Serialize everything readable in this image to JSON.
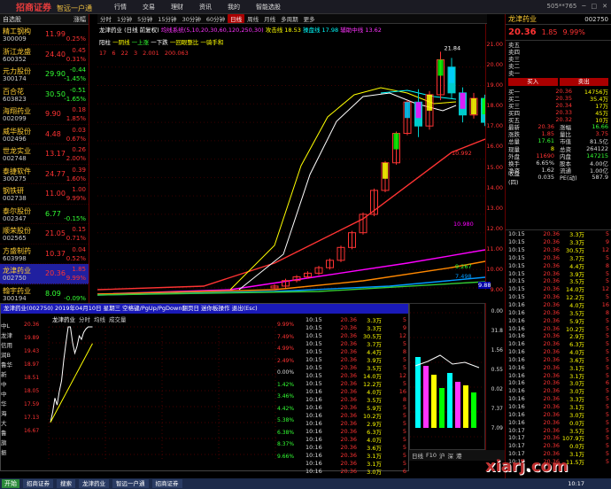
{
  "app": {
    "logo": "招商证券",
    "slogan": "智远一户通",
    "menu": [
      "行情",
      "交易",
      "理财",
      "资讯",
      "我的",
      "智能选股"
    ],
    "title_right": [
      "505**765",
      "─",
      "□",
      "✕"
    ]
  },
  "left_list": {
    "header_left": "自选股",
    "header_right": "涨幅",
    "rows": [
      {
        "name": "精工钢构",
        "code": "300009",
        "price": "11.99",
        "pct": "0.25%",
        "val": "",
        "color": "#f33"
      },
      {
        "name": "浙江龙盛",
        "code": "600352",
        "price": "24.40",
        "pct": "0.31%",
        "val": "0.45",
        "color": "#f33"
      },
      {
        "name": "元力股份",
        "code": "300174",
        "price": "29.90",
        "pct": "-1.45%",
        "val": "-0.44",
        "color": "#3f3"
      },
      {
        "name": "百合花",
        "code": "603823",
        "price": "30.50",
        "pct": "-1.65%",
        "val": "-0.51",
        "color": "#3f3"
      },
      {
        "name": "海翔药业",
        "code": "002099",
        "price": "9.90",
        "pct": "1.85%",
        "val": "0.18",
        "color": "#f33"
      },
      {
        "name": "威华股份",
        "code": "002496",
        "price": "4.48",
        "pct": "0.67%",
        "val": "0.03",
        "color": "#f33"
      },
      {
        "name": "世龙实业",
        "code": "002748",
        "price": "13.17",
        "price_color": "#f33",
        "pct": "2.00%",
        "val": "0.26",
        "color": "#f33"
      },
      {
        "name": "泰捷软件",
        "code": "300275",
        "price": "24.77",
        "pct": "1.60%",
        "val": "0.39",
        "color": "#f33"
      },
      {
        "name": "钢铁研",
        "code": "002738",
        "price": "11.00",
        "pct": "9.99%",
        "val": "1.00",
        "color": "#f33"
      },
      {
        "name": "泰尔股份",
        "code": "002347",
        "price": "6.77",
        "pct": "-0.15%",
        "val": "",
        "color": "#3f3"
      },
      {
        "name": "顺荣股份",
        "code": "002565",
        "price": "21.05",
        "pct": "0.71%",
        "val": "0.15",
        "color": "#f33"
      },
      {
        "name": "方盛制药",
        "code": "603998",
        "price": "10.37",
        "pct": "0.52%",
        "val": "0.04",
        "color": "#f33"
      },
      {
        "name": "龙津药业",
        "code": "002750",
        "price": "20.36",
        "pct": "9.99%",
        "val": "1.85",
        "color": "#f33"
      },
      {
        "name": "翰宇药业",
        "code": "300194",
        "price": "8.09",
        "pct": "-0.09%",
        "val": "",
        "color": "#3f3"
      }
    ]
  },
  "chart": {
    "toolbar": [
      "分时",
      "1分钟",
      "5分钟",
      "15分钟",
      "30分钟",
      "60分钟",
      "日线",
      "周线",
      "月线",
      "多周期",
      "更多"
    ],
    "toolbar_active": "日线",
    "ma_legend_title": "龙津药业 (日线 前复权)",
    "ma_legend_params": "均线系统(5,10,20,30,60,120,250,30)",
    "ma_legend_extra1": "攻击线 18.53",
    "ma_legend_extra2": "操盘线 17.98",
    "ma_legend_extra3": "辅助中线 13.62",
    "pattern_line": [
      "阳柱",
      "一阴线",
      "一上涨",
      "一下跌",
      "一回眼整比",
      "一骑手和"
    ],
    "pattern_values": [
      "17",
      "6",
      "22",
      "3",
      "2.001",
      "200.063"
    ],
    "annotations": {
      "high": "21.84",
      "low": "9.17",
      "ma1": "10.992",
      "ma2": "10.980",
      "ma3": "9.267",
      "ma4": "7.498",
      "v1": "9.88",
      "v2": "9.80"
    },
    "bottom_labels": [
      "买进",
      "卖出"
    ],
    "price_axis": [
      "21.00",
      "20.00",
      "19.00",
      "18.00",
      "17.00",
      "16.00",
      "15.00",
      "14.00",
      "13.00",
      "12.00",
      "11.00",
      "10.00",
      "9.00"
    ],
    "chart_data": {
      "type": "candlestick",
      "candles": [
        {
          "open": 9.0,
          "close": 9.1,
          "high": 9.2,
          "low": 8.9
        },
        {
          "open": 9.1,
          "close": 9.4,
          "high": 9.5,
          "low": 9.0
        },
        {
          "open": 9.4,
          "close": 9.6,
          "high": 9.7,
          "low": 9.3
        },
        {
          "open": 9.6,
          "close": 9.8,
          "high": 9.9,
          "low": 9.5
        },
        {
          "open": 9.8,
          "close": 10.1,
          "high": 10.2,
          "low": 9.7
        },
        {
          "open": 10.1,
          "close": 10.5,
          "high": 10.6,
          "low": 10.0
        },
        {
          "open": 10.5,
          "close": 11.2,
          "high": 11.3,
          "low": 10.4
        },
        {
          "open": 11.2,
          "close": 12.0,
          "high": 12.1,
          "low": 11.1
        },
        {
          "open": 12.0,
          "close": 13.0,
          "high": 13.1,
          "low": 11.9
        },
        {
          "open": 13.0,
          "close": 14.3,
          "high": 14.4,
          "low": 12.9
        },
        {
          "open": 14.3,
          "close": 15.8,
          "high": 15.9,
          "low": 14.2
        },
        {
          "open": 15.8,
          "close": 17.4,
          "high": 17.5,
          "low": 15.7
        },
        {
          "open": 17.4,
          "close": 19.1,
          "high": 19.2,
          "low": 17.3
        },
        {
          "open": 19.1,
          "close": 17.8,
          "high": 19.8,
          "low": 17.2
        },
        {
          "open": 17.8,
          "close": 19.5,
          "high": 19.7,
          "low": 17.6
        },
        {
          "open": 19.5,
          "close": 21.4,
          "high": 21.84,
          "low": 19.2
        },
        {
          "open": 21.0,
          "close": 19.6,
          "high": 21.5,
          "low": 19.3
        },
        {
          "open": 19.6,
          "close": 18.4,
          "high": 19.9,
          "low": 18.0
        },
        {
          "open": 18.4,
          "close": 19.3,
          "high": 19.6,
          "low": 18.2
        },
        {
          "open": 19.3,
          "close": 18.0,
          "high": 19.5,
          "low": 17.8
        },
        {
          "open": 18.0,
          "close": 17.2,
          "high": 18.3,
          "low": 16.9
        },
        {
          "open": 17.2,
          "close": 18.1,
          "high": 18.4,
          "low": 17.0
        },
        {
          "open": 18.1,
          "close": 17.5,
          "high": 18.3,
          "low": 17.2
        },
        {
          "open": 17.5,
          "close": 18.51,
          "high": 18.8,
          "low": 17.3
        },
        {
          "open": 18.51,
          "close": 20.36,
          "high": 20.36,
          "low": 18.5
        }
      ],
      "ylim": [
        9,
        22
      ]
    }
  },
  "quote": {
    "name": "龙津药业",
    "code": "002750",
    "price": "20.36",
    "change": "1.85",
    "pct": "9.99%",
    "asks": [
      {
        "l": "卖五",
        "v": "",
        "q": ""
      },
      {
        "l": "卖四",
        "v": "",
        "q": ""
      },
      {
        "l": "卖三",
        "v": "",
        "q": ""
      },
      {
        "l": "卖二",
        "v": "",
        "q": ""
      },
      {
        "l": "卖一",
        "v": "",
        "q": ""
      }
    ],
    "bids": [
      {
        "l": "买一",
        "v": "20.36",
        "q": "14756万"
      },
      {
        "l": "买二",
        "v": "20.35",
        "q": "35.4万"
      },
      {
        "l": "买三",
        "v": "20.34",
        "q": "17万"
      },
      {
        "l": "买四",
        "v": "20.33",
        "q": "45万"
      },
      {
        "l": "买五",
        "v": "20.32",
        "q": "10万"
      }
    ],
    "buttons": [
      "买入",
      "卖出"
    ],
    "stats": [
      {
        "k": "最新",
        "v": "20.36",
        "vc": "red",
        "k2": "涨幅",
        "v2": "16.66",
        "v2c": "grn"
      },
      {
        "k": "涨跌",
        "v": "1.85",
        "vc": "red",
        "k2": "量比",
        "v2": "3.75",
        "v2c": "red"
      },
      {
        "k": "总量",
        "v": "17.61",
        "vc": "grn",
        "k2": "市值",
        "v2": "81.5亿",
        "v2c": "wht"
      },
      {
        "k": "现量",
        "v": "8",
        "vc": "yel",
        "k2": "总资",
        "v2": "264122",
        "v2c": "wht"
      },
      {
        "k": "外盘",
        "v": "11690",
        "vc": "red",
        "k2": "内盘",
        "v2": "147215",
        "v2c": "grn"
      },
      {
        "k": "换手",
        "v": "6.65%",
        "vc": "wht",
        "k2": "股本",
        "v2": "4.00亿",
        "v2c": "wht"
      },
      {
        "k": "净资",
        "v": "1.62",
        "vc": "wht",
        "k2": "流通",
        "v2": "1.00亿",
        "v2c": "wht"
      },
      {
        "k": "收益(四)",
        "v": "0.035",
        "vc": "wht",
        "k2": "PE(动)",
        "v2": "587.9",
        "v2c": "wht"
      }
    ],
    "ticks": [
      {
        "t": "10:15",
        "p": "20.36",
        "v": "3.3万",
        "d": "5"
      },
      {
        "t": "10:15",
        "p": "20.36",
        "v": "3.3万",
        "d": "9"
      },
      {
        "t": "10:15",
        "p": "20.36",
        "v": "30.5万",
        "d": "12"
      },
      {
        "t": "10:15",
        "p": "20.36",
        "v": "3.7万",
        "d": "5"
      },
      {
        "t": "10:15",
        "p": "20.36",
        "v": "4.4万",
        "d": "8"
      },
      {
        "t": "10:15",
        "p": "20.36",
        "v": "3.9万",
        "d": "5"
      },
      {
        "t": "10:15",
        "p": "20.36",
        "v": "3.5万",
        "d": "5"
      },
      {
        "t": "10:15",
        "p": "20.36",
        "v": "14.0万",
        "d": "12"
      },
      {
        "t": "10:15",
        "p": "20.36",
        "v": "12.2万",
        "d": "5"
      },
      {
        "t": "10:16",
        "p": "20.36",
        "v": "4.0万",
        "d": "16"
      },
      {
        "t": "10:16",
        "p": "20.36",
        "v": "3.5万",
        "d": "8"
      },
      {
        "t": "10:16",
        "p": "20.36",
        "v": "5.9万",
        "d": "5"
      },
      {
        "t": "10:16",
        "p": "20.36",
        "v": "10.2万",
        "d": "5"
      },
      {
        "t": "10:16",
        "p": "20.36",
        "v": "2.9万",
        "d": "5"
      },
      {
        "t": "10:16",
        "p": "20.36",
        "v": "6.3万",
        "d": "5"
      },
      {
        "t": "10:16",
        "p": "20.36",
        "v": "4.0万",
        "d": "5"
      },
      {
        "t": "10:16",
        "p": "20.36",
        "v": "3.6万",
        "d": "5"
      },
      {
        "t": "10:16",
        "p": "20.36",
        "v": "3.1万",
        "d": "5"
      },
      {
        "t": "10:16",
        "p": "20.36",
        "v": "3.1万",
        "d": "5"
      },
      {
        "t": "10:16",
        "p": "20.36",
        "v": "3.0万",
        "d": "6"
      },
      {
        "t": "10:16",
        "p": "20.36",
        "v": "3.0万",
        "d": "5"
      },
      {
        "t": "10:16",
        "p": "20.36",
        "v": "3.3万",
        "d": "5"
      },
      {
        "t": "10:16",
        "p": "20.36",
        "v": "3.1万",
        "d": "5"
      },
      {
        "t": "10:16",
        "p": "20.36",
        "v": "3.0万",
        "d": "5"
      },
      {
        "t": "10:16",
        "p": "20.36",
        "v": "0.0万",
        "d": "5"
      },
      {
        "t": "10:17",
        "p": "20.36",
        "v": "3.5万",
        "d": "5"
      },
      {
        "t": "10:17",
        "p": "20.36",
        "v": "107.9万",
        "d": "5"
      },
      {
        "t": "10:17",
        "p": "20.36",
        "v": "0.0万",
        "d": "5"
      },
      {
        "t": "10:17",
        "p": "20.36",
        "v": "3.1万",
        "d": "5"
      },
      {
        "t": "10:17",
        "p": "20.36",
        "v": "11.5万",
        "d": "5"
      }
    ]
  },
  "popup": {
    "title": "龙津药业(002750) 2019年04月10日 星期三 空格键/PgUp/PgDown翻页日 迷你板操作 退出(Esc)",
    "tabs": [
      "龙津药业",
      "分时",
      "均线",
      "成交量"
    ],
    "left_axis": [
      "20.36",
      "19.89",
      "19.43",
      "18.97",
      "18.51",
      "18.05",
      "17.59",
      "17.13",
      "16.67"
    ],
    "right_axis": [
      "9.99%",
      "7.49%",
      "4.99%",
      "2.49%",
      "0.00%",
      "1.42%",
      "3.46%",
      "4.42%",
      "5.38%",
      "6.38%",
      "8.37%",
      "9.66%"
    ],
    "mini_ticks": [
      {
        "t": "10:15",
        "p": "20.36",
        "v": "3.3万",
        "d": "5"
      },
      {
        "t": "10:15",
        "p": "20.36",
        "v": "3.3万",
        "d": "9"
      },
      {
        "t": "10:15",
        "p": "20.36",
        "v": "30.5万",
        "d": "12"
      },
      {
        "t": "10:15",
        "p": "20.36",
        "v": "3.7万",
        "d": "5"
      },
      {
        "t": "10:15",
        "p": "20.36",
        "v": "4.4万",
        "d": "8"
      },
      {
        "t": "10:15",
        "p": "20.36",
        "v": "3.9万",
        "d": "5"
      },
      {
        "t": "10:15",
        "p": "20.36",
        "v": "3.5万",
        "d": "5"
      },
      {
        "t": "10:15",
        "p": "20.36",
        "v": "14.0万",
        "d": "12"
      },
      {
        "t": "10:15",
        "p": "20.36",
        "v": "12.2万",
        "d": "5"
      },
      {
        "t": "10:16",
        "p": "20.36",
        "v": "4.0万",
        "d": "16"
      },
      {
        "t": "10:16",
        "p": "20.36",
        "v": "3.5万",
        "d": "8"
      },
      {
        "t": "10:16",
        "p": "20.36",
        "v": "5.9万",
        "d": "5"
      },
      {
        "t": "10:16",
        "p": "20.36",
        "v": "10.2万",
        "d": "5"
      },
      {
        "t": "10:16",
        "p": "20.36",
        "v": "2.9万",
        "d": "5"
      },
      {
        "t": "10:16",
        "p": "20.36",
        "v": "6.3万",
        "d": "5"
      },
      {
        "t": "10:16",
        "p": "20.36",
        "v": "4.0万",
        "d": "5"
      },
      {
        "t": "10:16",
        "p": "20.36",
        "v": "3.6万",
        "d": "5"
      },
      {
        "t": "10:16",
        "p": "20.36",
        "v": "3.1万",
        "d": "5"
      },
      {
        "t": "10:16",
        "p": "20.36",
        "v": "3.1万",
        "d": "5"
      },
      {
        "t": "10:16",
        "p": "20.36",
        "v": "3.0万",
        "d": "6"
      }
    ],
    "partial_labels": [
      "中L",
      "龙津",
      "信用",
      "润B",
      "鲁华",
      "新",
      "中",
      "中",
      "华",
      "海",
      "大",
      "鲁",
      "旗",
      "振"
    ],
    "intraday_data": {
      "prices": [
        17.6,
        17.9,
        18.3,
        18.1,
        18.5,
        18.8,
        19.4,
        19.9,
        20.36,
        20.36,
        19.9,
        19.6,
        19.8,
        20.1,
        20.0,
        20.2,
        20.3,
        20.36,
        20.36,
        20.36
      ],
      "ylim": [
        16.67,
        20.36
      ]
    }
  },
  "mid_axis": [
    "0.00",
    "31.8",
    "1.56",
    "0.55",
    "0.02",
    "7.37",
    "7.09"
  ],
  "bottom_tabs": [
    "日线",
    "F10",
    "沪",
    "深",
    "港"
  ],
  "taskbar": {
    "start": "开始",
    "items": [
      "招商证券",
      "搜索",
      "龙津药业",
      "智远一户通",
      "招商证券"
    ],
    "time": "10:17"
  },
  "watermark": {
    "a": "xiarj",
    "b": ".",
    "c": "com"
  },
  "crosshair": {
    "price": "9.88",
    "date": "9.80"
  }
}
